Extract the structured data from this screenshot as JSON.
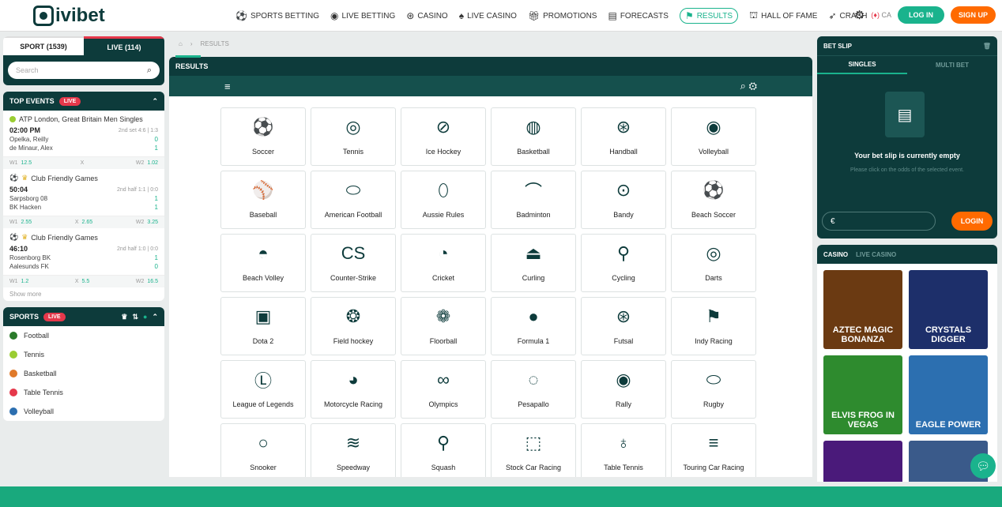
{
  "brand": {
    "name": "ivibet"
  },
  "nav": [
    {
      "label": "SPORTS BETTING",
      "icon": "soccer-ball-icon"
    },
    {
      "label": "LIVE BETTING",
      "icon": "live-icon"
    },
    {
      "label": "CASINO",
      "icon": "chip-icon"
    },
    {
      "label": "LIVE CASINO",
      "icon": "dealer-icon"
    },
    {
      "label": "PROMOTIONS",
      "icon": "gift-icon"
    },
    {
      "label": "FORECASTS",
      "icon": "forecast-icon"
    },
    {
      "label": "RESULTS",
      "icon": "trophy-icon",
      "active": true
    },
    {
      "label": "HALL OF FAME",
      "icon": "podium-icon"
    },
    {
      "label": "CRASH",
      "icon": "rocket-icon"
    }
  ],
  "top_right": {
    "country": "CA",
    "login": "LOG IN",
    "signup": "SIGN UP"
  },
  "left": {
    "tab_sport": "SPORT (1539)",
    "tab_live": "LIVE (114)",
    "search_placeholder": "Search",
    "top_events_title": "TOP EVENTS",
    "live_badge": "LIVE",
    "events": [
      {
        "title": "ATP London, Great Britain Men Singles",
        "time": "02:00 PM",
        "status": "2nd set 4:6 | 1:3",
        "team1": "Opelka, Reilly",
        "score1": "0",
        "team2": "de Minaur, Alex",
        "score2": "1",
        "w1_label": "W1",
        "w1": "12.5",
        "x_label": "X",
        "x": "",
        "w2_label": "W2",
        "w2": "1.02"
      },
      {
        "title": "Club Friendly Games",
        "time": "50:04",
        "status": "2nd half 1:1 | 0:0",
        "team1": "Sarpsborg 08",
        "score1": "1",
        "team2": "BK Hacken",
        "score2": "1",
        "w1_label": "W1",
        "w1": "2.55",
        "x_label": "X",
        "x": "2.65",
        "w2_label": "W2",
        "w2": "3.25"
      },
      {
        "title": "Club Friendly Games",
        "time": "46:10",
        "status": "2nd half 1:0 | 0:0",
        "team1": "Rosenborg BK",
        "score1": "1",
        "team2": "Aalesunds FK",
        "score2": "0",
        "w1_label": "W1",
        "w1": "1.2",
        "x_label": "X",
        "x": "5.5",
        "w2_label": "W2",
        "w2": "16.5"
      }
    ],
    "show_more": "Show more",
    "sports_title": "SPORTS",
    "sports": [
      {
        "label": "Football",
        "color": "#2a7a2a"
      },
      {
        "label": "Tennis",
        "color": "#9acd32"
      },
      {
        "label": "Basketball",
        "color": "#e07a2a"
      },
      {
        "label": "Table Tennis",
        "color": "#e5384b"
      },
      {
        "label": "Volleyball",
        "color": "#2c6fb0"
      }
    ]
  },
  "main": {
    "breadcrumb": "RESULTS",
    "title": "RESULTS",
    "sports_grid": [
      {
        "label": "Soccer",
        "glyph": "⚽"
      },
      {
        "label": "Tennis",
        "glyph": "◎"
      },
      {
        "label": "Ice Hockey",
        "glyph": "⊘"
      },
      {
        "label": "Basketball",
        "glyph": "◍"
      },
      {
        "label": "Handball",
        "glyph": "⊛"
      },
      {
        "label": "Volleyball",
        "glyph": "◉"
      },
      {
        "label": "Baseball",
        "glyph": "⚾"
      },
      {
        "label": "American Football",
        "glyph": "⬭"
      },
      {
        "label": "Aussie Rules",
        "glyph": "⬯"
      },
      {
        "label": "Badminton",
        "glyph": "⌒"
      },
      {
        "label": "Bandy",
        "glyph": "⊙"
      },
      {
        "label": "Beach Soccer",
        "glyph": "⚽"
      },
      {
        "label": "Beach Volley",
        "glyph": "◓"
      },
      {
        "label": "Counter-Strike",
        "glyph": "CS"
      },
      {
        "label": "Cricket",
        "glyph": "◔"
      },
      {
        "label": "Curling",
        "glyph": "⏏"
      },
      {
        "label": "Cycling",
        "glyph": "⚲"
      },
      {
        "label": "Darts",
        "glyph": "◎"
      },
      {
        "label": "Dota 2",
        "glyph": "▣"
      },
      {
        "label": "Field hockey",
        "glyph": "❂"
      },
      {
        "label": "Floorball",
        "glyph": "❁"
      },
      {
        "label": "Formula 1",
        "glyph": "●"
      },
      {
        "label": "Futsal",
        "glyph": "⊛"
      },
      {
        "label": "Indy Racing",
        "glyph": "⚑"
      },
      {
        "label": "League of Legends",
        "glyph": "Ⓛ"
      },
      {
        "label": "Motorcycle Racing",
        "glyph": "◕"
      },
      {
        "label": "Olympics",
        "glyph": "∞"
      },
      {
        "label": "Pesapallo",
        "glyph": "◌"
      },
      {
        "label": "Rally",
        "glyph": "◉"
      },
      {
        "label": "Rugby",
        "glyph": "⬭"
      },
      {
        "label": "Snooker",
        "glyph": "○"
      },
      {
        "label": "Speedway",
        "glyph": "≋"
      },
      {
        "label": "Squash",
        "glyph": "⚲"
      },
      {
        "label": "Stock Car Racing",
        "glyph": "⬚"
      },
      {
        "label": "Table Tennis",
        "glyph": "♁"
      },
      {
        "label": "Touring Car Racing",
        "glyph": "≡"
      }
    ]
  },
  "betslip": {
    "title": "BET SLIP",
    "tab_singles": "SINGLES",
    "tab_multi": "MULTI BET",
    "empty_title": "Your bet slip is currently empty",
    "empty_hint": "Please click on the odds of the selected event.",
    "currency": "€",
    "login": "LOGIN"
  },
  "casino": {
    "tab_casino": "CASINO",
    "tab_live": "LIVE CASINO",
    "games": [
      "AZTEC MAGIC BONANZA",
      "CRYSTALS DIGGER",
      "ELVIS FROG IN VEGAS",
      "EAGLE POWER",
      "",
      ""
    ]
  }
}
